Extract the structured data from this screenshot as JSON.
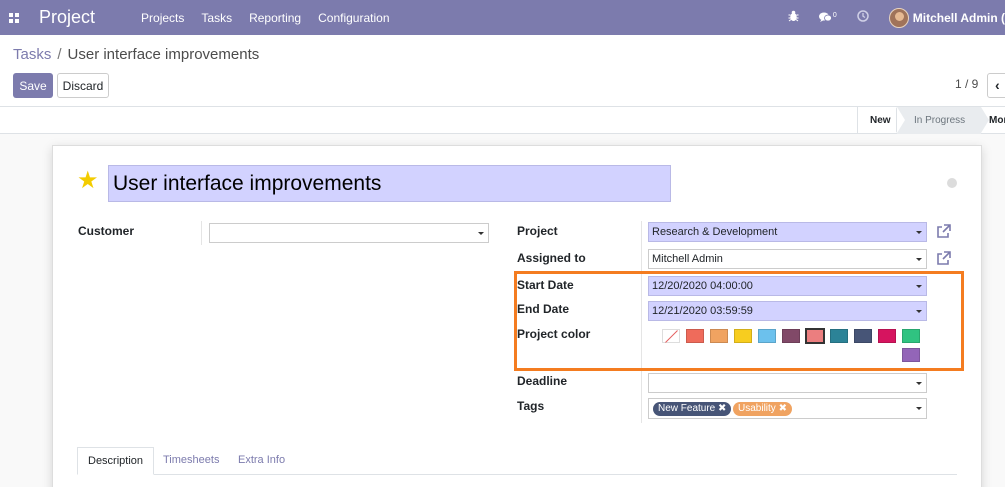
{
  "navbar": {
    "app_title": "Project",
    "menu": [
      "Projects",
      "Tasks",
      "Reporting",
      "Configuration"
    ],
    "chat_badge": "0",
    "user_name": "Mitchell Admin ("
  },
  "breadcrumb": {
    "parent": "Tasks",
    "separator": "/",
    "current": "User interface improvements"
  },
  "buttons": {
    "save": "Save",
    "discard": "Discard"
  },
  "pager": {
    "value": "1 / 9",
    "prev_icon": "‹"
  },
  "stages": {
    "new": "New",
    "in_progress": "In Progress",
    "more": "Mor"
  },
  "task": {
    "title": "User interface improvements"
  },
  "fields": {
    "customer": {
      "label": "Customer",
      "value": ""
    },
    "project": {
      "label": "Project",
      "value": "Research & Development"
    },
    "assigned_to": {
      "label": "Assigned to",
      "value": "Mitchell Admin"
    },
    "start_date": {
      "label": "Start Date",
      "value": "12/20/2020 04:00:00"
    },
    "end_date": {
      "label": "End Date",
      "value": "12/21/2020 03:59:59"
    },
    "project_color": {
      "label": "Project color"
    },
    "deadline": {
      "label": "Deadline",
      "value": ""
    },
    "tags": {
      "label": "Tags"
    }
  },
  "colors": {
    "accent": "#7c7bad",
    "highlight_box": "#f47c20",
    "star": "#f3cc00",
    "swatches": [
      "none",
      "#ef6b5b",
      "#f0a361",
      "#f7cd1f",
      "#6cc1ed",
      "#814968",
      "#eb7e7f",
      "#2c8397",
      "#475577",
      "#d6145f",
      "#30c381",
      "#9365b8"
    ],
    "selected_swatch_index": 6
  },
  "tags": [
    {
      "label": "New Feature",
      "remove_icon": "✖",
      "color": "#475577"
    },
    {
      "label": "Usability",
      "remove_icon": "✖",
      "color": "#f0a361"
    }
  ],
  "tabs": [
    "Description",
    "Timesheets",
    "Extra Info"
  ]
}
